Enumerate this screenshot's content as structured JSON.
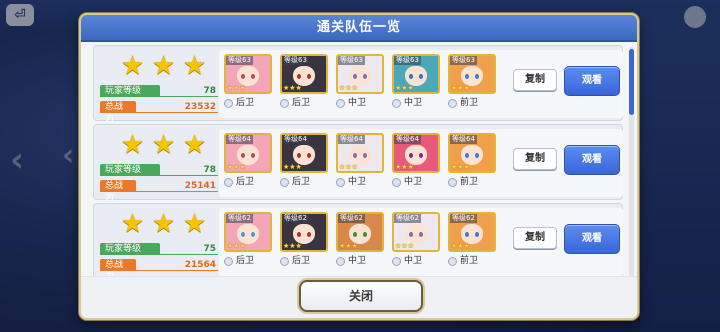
{
  "dialog": {
    "title": "通关队伍一览",
    "close_label": "关闭"
  },
  "labels": {
    "player_level": "玩家等级",
    "power": "总战力",
    "copy": "复制",
    "view": "观看",
    "star_glyph": "★"
  },
  "teams": [
    {
      "stars": 3,
      "player_level": "78",
      "power": "23532",
      "units": [
        {
          "level": "等级63",
          "stars": "★★★",
          "position": "后卫",
          "hair": "#f3a6b8",
          "eyes": "#c0485e",
          "frame": "#e0b63a"
        },
        {
          "level": "等级63",
          "stars": "★★★",
          "position": "后卫",
          "hair": "#3a3440",
          "eyes": "#b03030",
          "frame": "#e0b63a"
        },
        {
          "level": "等级63",
          "stars": "★★★",
          "position": "中卫",
          "hair": "#eee8ee",
          "eyes": "#8a6ab0",
          "frame": "#e0b63a"
        },
        {
          "level": "等级63",
          "stars": "★★★",
          "position": "中卫",
          "hair": "#4aa8b8",
          "eyes": "#3a70c0",
          "frame": "#e0b63a"
        },
        {
          "level": "等级63",
          "stars": "★★★",
          "position": "前卫",
          "hair": "#f0a04a",
          "eyes": "#3a80d0",
          "frame": "#e0b63a"
        }
      ]
    },
    {
      "stars": 3,
      "player_level": "78",
      "power": "25141",
      "units": [
        {
          "level": "等级64",
          "stars": "★★★",
          "position": "后卫",
          "hair": "#f3a6b8",
          "eyes": "#c0485e",
          "frame": "#e0b63a"
        },
        {
          "level": "等级64",
          "stars": "★★★",
          "position": "后卫",
          "hair": "#3a3440",
          "eyes": "#b03030",
          "frame": "#e0b63a"
        },
        {
          "level": "等级64",
          "stars": "★★★",
          "position": "中卫",
          "hair": "#eee8ee",
          "eyes": "#8a6ab0",
          "frame": "#e0b63a"
        },
        {
          "level": "等级64",
          "stars": "★★★",
          "position": "中卫",
          "hair": "#e85a7a",
          "eyes": "#7a2a8a",
          "frame": "#e0b63a"
        },
        {
          "level": "等级64",
          "stars": "★★★",
          "position": "前卫",
          "hair": "#f0a04a",
          "eyes": "#3a80d0",
          "frame": "#e0b63a"
        }
      ]
    },
    {
      "stars": 3,
      "player_level": "75",
      "power": "21564",
      "units": [
        {
          "level": "等级62",
          "stars": "★★★",
          "position": "后卫",
          "hair": "#f3a6b8",
          "eyes": "#4a9ad0",
          "frame": "#e0b63a"
        },
        {
          "level": "等级62",
          "stars": "★★★",
          "position": "后卫",
          "hair": "#3a3440",
          "eyes": "#b03030",
          "frame": "#e0b63a"
        },
        {
          "level": "等级62",
          "stars": "★★★",
          "position": "中卫",
          "hair": "#d8884a",
          "eyes": "#4a8a3a",
          "frame": "#e0b63a"
        },
        {
          "level": "等级62",
          "stars": "★★★",
          "position": "中卫",
          "hair": "#eee8ee",
          "eyes": "#8a6ab0",
          "frame": "#e0b63a"
        },
        {
          "level": "等级62",
          "stars": "★★★",
          "position": "前卫",
          "hair": "#f0a04a",
          "eyes": "#3a80d0",
          "frame": "#e0b63a"
        }
      ]
    }
  ]
}
